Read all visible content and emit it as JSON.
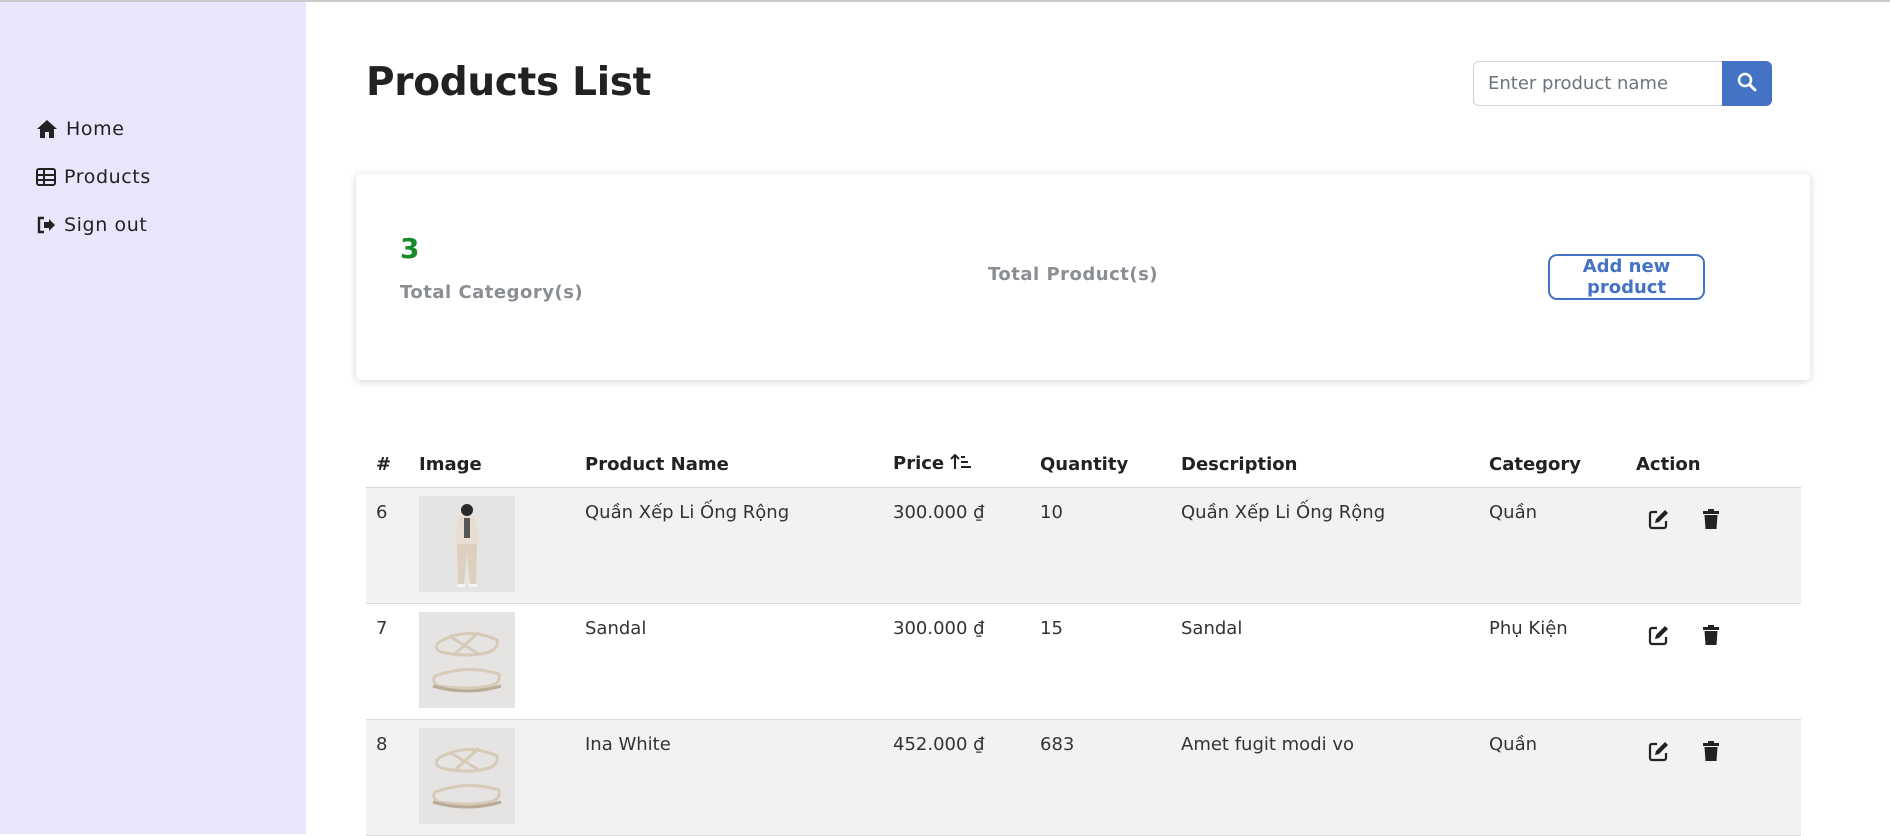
{
  "sidebar": {
    "items": [
      {
        "label": "Home",
        "icon": "home-icon"
      },
      {
        "label": "Products",
        "icon": "table-icon"
      },
      {
        "label": "Sign out",
        "icon": "sign-out-icon"
      }
    ]
  },
  "header": {
    "title": "Products List",
    "search": {
      "placeholder": "Enter product name",
      "value": "",
      "icon": "search-icon"
    }
  },
  "stats": {
    "categories_value": "3",
    "categories_label": "Total Category(s)",
    "products_value": "",
    "products_label": "Total Product(s)",
    "add_button": "Add new product"
  },
  "table": {
    "headers": {
      "index": "#",
      "image": "Image",
      "name": "Product Name",
      "price": "Price",
      "quantity": "Quantity",
      "description": "Description",
      "category": "Category",
      "action": "Action"
    },
    "price_sort_icon": "sort-ascending-icon",
    "rows": [
      {
        "id": "6",
        "name": "Quần Xếp Li Ống Rộng",
        "price": "300.000 ₫",
        "quantity": "10",
        "description": "Quần Xếp Li Ống Rộng",
        "category": "Quần",
        "image": "model-wearing-beige-pants"
      },
      {
        "id": "7",
        "name": "Sandal",
        "price": "300.000 ₫",
        "quantity": "15",
        "description": "Sandal",
        "category": "Phụ Kiện",
        "image": "strappy-sandals"
      },
      {
        "id": "8",
        "name": "Ina White",
        "price": "452.000 ₫",
        "quantity": "683",
        "description": "Amet fugit modi vo",
        "category": "Quần",
        "image": "strappy-sandals"
      }
    ]
  },
  "colors": {
    "sidebar_bg": "#e9e6fb",
    "accent": "#4472c4",
    "stat_green": "#198a2a",
    "row_alt": "#f2f2f2"
  }
}
